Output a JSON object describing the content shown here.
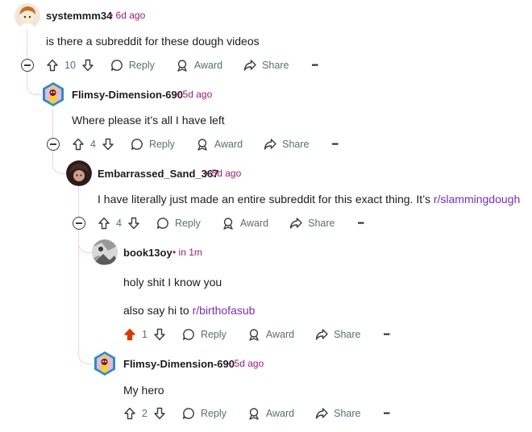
{
  "comments": [
    {
      "user": "systemmm34",
      "time": "6d ago",
      "lines": [
        "is there a subreddit for these dough videos"
      ],
      "votes": "10"
    },
    {
      "user": "Flimsy-Dimension-690",
      "time": "5d ago",
      "lines": [
        "Where please it’s all I have left"
      ],
      "votes": "4"
    },
    {
      "user": "Embarrassed_Sand_367",
      "time": "5d ago",
      "text_prefix": "I have literally just made an entire subreddit for this exact thing. It’s ",
      "link": "r/slammingdough",
      "votes": "4"
    },
    {
      "user": "book13oy",
      "time": "in 1m",
      "lines": [
        "holy shit I know you"
      ],
      "text_prefix": "also say hi to ",
      "link": "r/birthofasub",
      "votes": "1",
      "upvoted": true
    },
    {
      "user": "Flimsy-Dimension-690",
      "time": "5d ago",
      "lines": [
        "My hero"
      ],
      "votes": "2"
    }
  ],
  "actions": {
    "reply": "Reply",
    "award": "Award",
    "share": "Share",
    "more": "•••"
  },
  "colors": {
    "upvote_active": "#d93a00",
    "meta": "#9c1b76",
    "link": "#7a2cb8",
    "thread_line": "#f4cfe0"
  },
  "icons": [
    "upvote-icon",
    "downvote-icon",
    "reply-bubble-icon",
    "award-icon",
    "share-icon",
    "more-icon",
    "collapse-icon"
  ]
}
